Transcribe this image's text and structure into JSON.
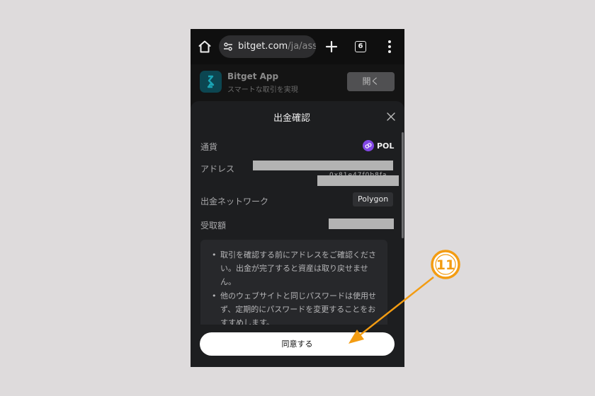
{
  "browser": {
    "url_domain": "bitget.com",
    "url_path": "/ja/ass",
    "tab_count": "6"
  },
  "app_banner": {
    "name": "Bitget App",
    "subtitle": "スマートな取引を実現",
    "open_label": "開く"
  },
  "sheet": {
    "title": "出金確認",
    "currency_label": "通貨",
    "currency_value": "POL",
    "address_label": "アドレス",
    "address_peek": "0x81e47f0b8fa",
    "network_label": "出金ネットワーク",
    "network_value": "Polygon",
    "amount_label": "受取額",
    "notices": [
      "取引を確認する前にアドレスをご確認ください。出金が完了すると資産は取り戻せません。",
      "他のウェブサイトと同じパスワードは使用せず、定期的にパスワードを変更することをおすすめします。"
    ],
    "agree_label": "同意する"
  },
  "annotation": {
    "step_number": "11",
    "color": "#f39c12"
  }
}
